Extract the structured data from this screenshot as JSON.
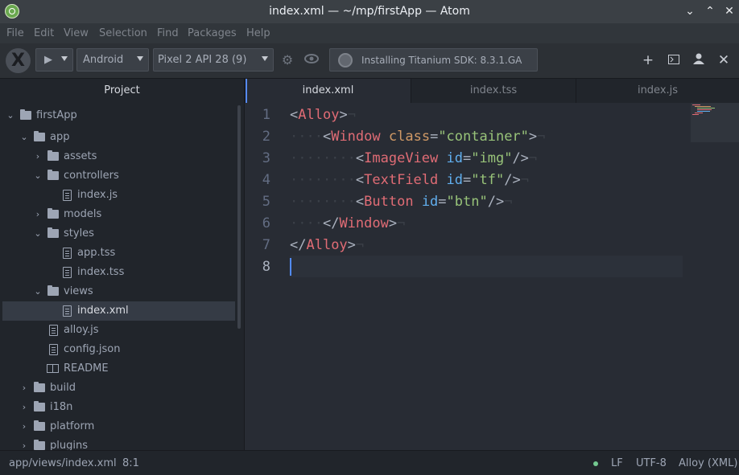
{
  "window": {
    "title": "index.xml — ~/mp/firstApp — Atom",
    "minimize": "⌄",
    "maximize": "⌃",
    "close": "✕"
  },
  "menu": [
    "File",
    "Edit",
    "View",
    "Selection",
    "Find",
    "Packages",
    "Help"
  ],
  "toolbar": {
    "logo": "X",
    "run": "▶",
    "platform": "Android",
    "device": "Pixel 2 API 28 (9)",
    "settings_icon": "⚙",
    "eye_icon": "👁",
    "status": "Installing Titanium SDK: 8.3.1.GA",
    "right_icons": [
      "+",
      "⊡",
      "👤",
      "✕"
    ]
  },
  "sidebar": {
    "header": "Project",
    "items": [
      {
        "label": "firstApp",
        "type": "folder",
        "expanded": true
      },
      {
        "label": "app",
        "type": "folder",
        "expanded": true
      },
      {
        "label": "assets",
        "type": "folder",
        "expanded": false
      },
      {
        "label": "controllers",
        "type": "folder",
        "expanded": true
      },
      {
        "label": "index.js",
        "type": "file"
      },
      {
        "label": "models",
        "type": "folder",
        "expanded": false
      },
      {
        "label": "styles",
        "type": "folder",
        "expanded": true
      },
      {
        "label": "app.tss",
        "type": "file"
      },
      {
        "label": "index.tss",
        "type": "file"
      },
      {
        "label": "views",
        "type": "folder",
        "expanded": true
      },
      {
        "label": "index.xml",
        "type": "file",
        "selected": true
      },
      {
        "label": "alloy.js",
        "type": "file"
      },
      {
        "label": "config.json",
        "type": "file"
      },
      {
        "label": "README",
        "type": "readme"
      },
      {
        "label": "build",
        "type": "folder",
        "expanded": false
      },
      {
        "label": "i18n",
        "type": "folder",
        "expanded": false
      },
      {
        "label": "platform",
        "type": "folder",
        "expanded": false
      },
      {
        "label": "plugins",
        "type": "folder",
        "expanded": false
      }
    ]
  },
  "tabs": [
    {
      "label": "index.xml",
      "active": true
    },
    {
      "label": "index.tss",
      "active": false
    },
    {
      "label": "index.js",
      "active": false
    }
  ],
  "editor": {
    "line_numbers": [
      "1",
      "2",
      "3",
      "4",
      "5",
      "6",
      "7",
      "8"
    ],
    "invisibles": {
      "space": "·",
      "eol": "¬"
    },
    "tokens": {
      "l1_open": "<",
      "l1_tag": "Alloy",
      "l1_close": ">",
      "l2_open": "<",
      "l2_tag": "Window",
      "l2_attr": "class",
      "l2_eq": "=",
      "l2_val": "\"container\"",
      "l2_close": ">",
      "l3_open": "<",
      "l3_tag": "ImageView",
      "l3_attr": "id",
      "l3_eq": "=",
      "l3_val": "\"img\"",
      "l3_close": "/>",
      "l4_open": "<",
      "l4_tag": "TextField",
      "l4_attr": "id",
      "l4_eq": "=",
      "l4_val": "\"tf\"",
      "l4_close": "/>",
      "l5_open": "<",
      "l5_tag": "Button",
      "l5_attr": "id",
      "l5_eq": "=",
      "l5_val": "\"btn\"",
      "l5_close": "/>",
      "l6_open": "</",
      "l6_tag": "Window",
      "l6_close": ">",
      "l7_open": "</",
      "l7_tag": "Alloy",
      "l7_close": ">"
    }
  },
  "status": {
    "path": "app/views/index.xml",
    "cursor": "8:1",
    "line_ending": "LF",
    "encoding": "UTF-8",
    "grammar": "Alloy (XML)"
  }
}
